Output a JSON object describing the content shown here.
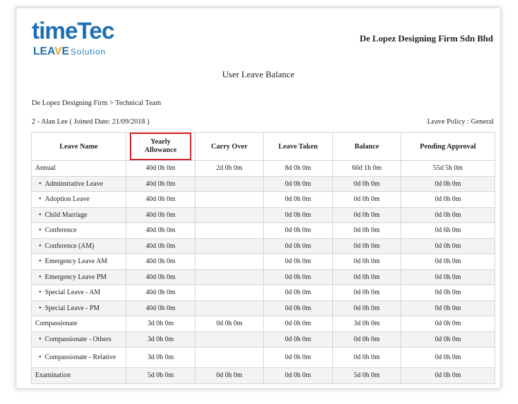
{
  "logo": {
    "time": "timeTec",
    "leave_prefix": "LEA",
    "leave_check": "V",
    "leave_suffix": "E",
    "solution": "Solution"
  },
  "company": "De Lopez Designing Firm Sdn Bhd",
  "report_title": "User Leave Balance",
  "path": "De Lopez Designing Firm > Technical Team",
  "employee": "2 - Alan Lee ( Joined Date: 21/09/2018 )",
  "leave_policy": "Leave Policy : General",
  "highlight_color": "#d9232d",
  "bullet": "•",
  "columns": [
    "Leave Name",
    "Yearly Allowance",
    "Carry Over",
    "Leave Taken",
    "Balance",
    "Pending Approval"
  ],
  "rows": [
    {
      "name": "Annual",
      "sub": false,
      "allowance": "40d 0h 0m",
      "carry": "2d 0h 0m",
      "taken": "8d 0h 0m",
      "balance": "60d 1h 0m",
      "pending": "55d 5h 0m"
    },
    {
      "name": "Adminstrative Leave",
      "sub": true,
      "allowance": "40d 0h 0m",
      "carry": "",
      "taken": "0d 0h 0m",
      "balance": "0d 0h 0m",
      "pending": "0d 0h 0m"
    },
    {
      "name": "Adoption Leave",
      "sub": true,
      "allowance": "40d 0h 0m",
      "carry": "",
      "taken": "0d 0h 0m",
      "balance": "0d 0h 0m",
      "pending": "0d 0h 0m"
    },
    {
      "name": "Child Marriage",
      "sub": true,
      "allowance": "40d 0h 0m",
      "carry": "",
      "taken": "0d 0h 0m",
      "balance": "0d 0h 0m",
      "pending": "0d 0h 0m"
    },
    {
      "name": "Conference",
      "sub": true,
      "allowance": "40d 0h 0m",
      "carry": "",
      "taken": "0d 0h 0m",
      "balance": "0d 0h 0m",
      "pending": "0d 6h 0m"
    },
    {
      "name": "Conference (AM)",
      "sub": true,
      "allowance": "40d 0h 0m",
      "carry": "",
      "taken": "0d 0h 0m",
      "balance": "0d 0h 0m",
      "pending": "0d 0h 0m"
    },
    {
      "name": "Emergency Leave AM",
      "sub": true,
      "allowance": "40d 0h 0m",
      "carry": "",
      "taken": "0d 0h 0m",
      "balance": "0d 0h 0m",
      "pending": "0d 0h 0m"
    },
    {
      "name": "Emergency Leave PM",
      "sub": true,
      "allowance": "40d 0h 0m",
      "carry": "",
      "taken": "0d 0h 0m",
      "balance": "0d 0h 0m",
      "pending": "0d 0h 0m"
    },
    {
      "name": "Special Leave - AM",
      "sub": true,
      "allowance": "40d 0h 0m",
      "carry": "",
      "taken": "0d 0h 0m",
      "balance": "0d 0h 0m",
      "pending": "0d 0h 0m"
    },
    {
      "name": "Special Leave - PM",
      "sub": true,
      "allowance": "40d 0h 0m",
      "carry": "",
      "taken": "0d 0h 0m",
      "balance": "0d 0h 0m",
      "pending": "0d 0h 0m"
    },
    {
      "name": "Compassionate",
      "sub": false,
      "allowance": "3d 0h 0m",
      "carry": "0d 0h 0m",
      "taken": "0d 0h 0m",
      "balance": "3d 0h 0m",
      "pending": "0d 0h 0m"
    },
    {
      "name": "Compassionate - Others",
      "sub": true,
      "allowance": "3d 0h 0m",
      "carry": "",
      "taken": "0d 0h 0m",
      "balance": "0d 0h 0m",
      "pending": "0d 0h 0m"
    },
    {
      "name": "Compassionate - Relative",
      "sub": true,
      "allowance": "3d 0h 0m",
      "carry": "",
      "taken": "0d 0h 0m",
      "balance": "0d 0h 0m",
      "pending": "0d 0h 0m"
    },
    {
      "name": "Examination",
      "sub": false,
      "allowance": "5d 0h 0m",
      "carry": "0d 0h 0m",
      "taken": "0d 0h 0m",
      "balance": "5d 0h 0m",
      "pending": "0d 0h 0m"
    }
  ]
}
